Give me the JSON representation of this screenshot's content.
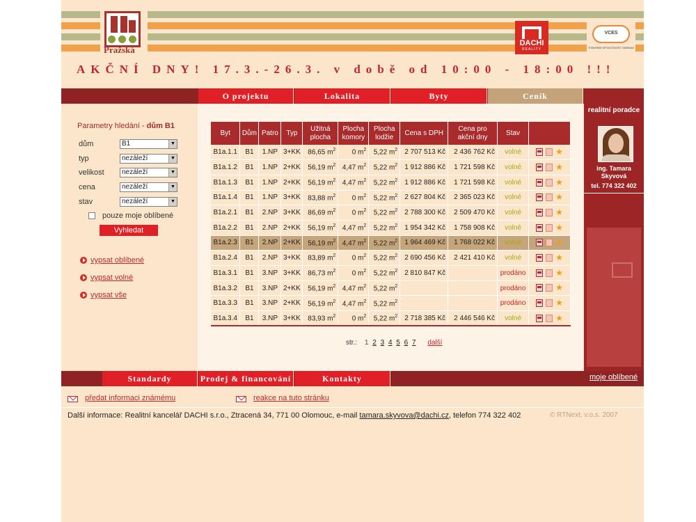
{
  "header": {
    "logo_text": "Pražská",
    "dachi_text": "DACHI",
    "dachi_sub": "REALITY",
    "vces_text": "VCES",
    "vces_sub": "STAVEBNÍ SPOLEČNOST OMNIUM"
  },
  "banner": "AKČNÍ DNY! 17.3.-26.3. v době od 10:00 - 18:00 !!!",
  "nav": [
    "O projektu",
    "Lokalita",
    "Byty",
    "Ceník"
  ],
  "search": {
    "title_prefix": "Parametry hledání - ",
    "title_house": "dům B1",
    "fields": [
      {
        "label": "dům",
        "value": "B1"
      },
      {
        "label": "typ",
        "value": "nezáleží"
      },
      {
        "label": "velikost",
        "value": "nezáleží"
      },
      {
        "label": "cena",
        "value": "nezáleží"
      },
      {
        "label": "stav",
        "value": "nezáleží"
      }
    ],
    "favorites_only": "pouze moje oblíbené",
    "button": "Vyhledat"
  },
  "side_links": [
    "vypsat oblíbené",
    "vypsat volné",
    "vypsat vše"
  ],
  "table": {
    "headers": [
      "Byt",
      "Dům",
      "Patro",
      "Typ",
      "Užitná plocha",
      "Plocha komory",
      "Plocha lodžie",
      "Cena s DPH",
      "Cena pro akční dny",
      "Stav",
      ""
    ],
    "rows": [
      {
        "byt": "B1a.1.1",
        "dum": "B1",
        "patro": "1.NP",
        "typ": "3+KK",
        "uzitna": "86,65 m",
        "komora": "0 m",
        "lodzie": "5,22 m",
        "cena": "2 707 513 Kč",
        "akce": "2 436 762 Kč",
        "stav": "volné"
      },
      {
        "byt": "B1a.1.2",
        "dum": "B1",
        "patro": "1.NP",
        "typ": "2+KK",
        "uzitna": "56,19 m",
        "komora": "4,47 m",
        "lodzie": "5,22 m",
        "cena": "1 912 886 Kč",
        "akce": "1 721 598 Kč",
        "stav": "volné"
      },
      {
        "byt": "B1a.1.3",
        "dum": "B1",
        "patro": "1.NP",
        "typ": "2+KK",
        "uzitna": "56,19 m",
        "komora": "4,47 m",
        "lodzie": "5,22 m",
        "cena": "1 912 886 Kč",
        "akce": "1 721 598 Kč",
        "stav": "volné"
      },
      {
        "byt": "B1a.1.4",
        "dum": "B1",
        "patro": "1.NP",
        "typ": "3+KK",
        "uzitna": "83,88 m",
        "komora": "0 m",
        "lodzie": "5,22 m",
        "cena": "2 627 804 Kč",
        "akce": "2 365 023 Kč",
        "stav": "volné"
      },
      {
        "byt": "B1a.2.1",
        "dum": "B1",
        "patro": "2.NP",
        "typ": "3+KK",
        "uzitna": "86,69 m",
        "komora": "0 m",
        "lodzie": "5,22 m",
        "cena": "2 788 300 Kč",
        "akce": "2 509 470 Kč",
        "stav": "volné"
      },
      {
        "byt": "B1a.2.2",
        "dum": "B1",
        "patro": "2.NP",
        "typ": "2+KK",
        "uzitna": "56,19 m",
        "komora": "4,47 m",
        "lodzie": "5,22 m",
        "cena": "1 954 342 Kč",
        "akce": "1 758 908 Kč",
        "stav": "volné"
      },
      {
        "byt": "B1a.2.3",
        "dum": "B1",
        "patro": "2.NP",
        "typ": "2+KK",
        "uzitna": "56,19 m",
        "komora": "4,47 m",
        "lodzie": "5,22 m",
        "cena": "1 964 469 Kč",
        "akce": "1 768 022 Kč",
        "stav": "volné",
        "highlight": true
      },
      {
        "byt": "B1a.2.4",
        "dum": "B1",
        "patro": "2.NP",
        "typ": "3+KK",
        "uzitna": "83,89 m",
        "komora": "0 m",
        "lodzie": "5,22 m",
        "cena": "2 690 456 Kč",
        "akce": "2 421 410 Kč",
        "stav": "volné"
      },
      {
        "byt": "B1a.3.1",
        "dum": "B1",
        "patro": "3.NP",
        "typ": "3+KK",
        "uzitna": "86,73 m",
        "komora": "0 m",
        "lodzie": "5,22 m",
        "cena": "2 810 847 Kč",
        "akce": "",
        "stav": "prodáno"
      },
      {
        "byt": "B1a.3.2",
        "dum": "B1",
        "patro": "3.NP",
        "typ": "2+KK",
        "uzitna": "56,19 m",
        "komora": "4,47 m",
        "lodzie": "5,22 m",
        "cena": "",
        "akce": "",
        "stav": "prodáno"
      },
      {
        "byt": "B1a.3.3",
        "dum": "B1",
        "patro": "3.NP",
        "typ": "2+KK",
        "uzitna": "56,19 m",
        "komora": "4,47 m",
        "lodzie": "5,22 m",
        "cena": "",
        "akce": "",
        "stav": "prodáno"
      },
      {
        "byt": "B1a.3.4",
        "dum": "B1",
        "patro": "3.NP",
        "typ": "3+KK",
        "uzitna": "83,93 m",
        "komora": "0 m",
        "lodzie": "5,22 m",
        "cena": "2 718 385 Kč",
        "akce": "2 446 546 Kč",
        "stav": "volné"
      }
    ],
    "area_unit_sup": "2",
    "action_icons": [
      "pdf-icon",
      "document-icon",
      "star-icon"
    ]
  },
  "pager": {
    "label": "str.:",
    "current": "1",
    "pages": [
      "2",
      "3",
      "4",
      "5",
      "6",
      "7"
    ],
    "next": "další"
  },
  "advisor": {
    "title": "realitní poradce",
    "name": "ing. Tamara Skyvová",
    "tel": "tel. 774 322 402"
  },
  "bottom_nav": [
    "Standardy",
    "Prodej & financování",
    "Kontakty"
  ],
  "favorites_link": "moje oblíbené",
  "footer": {
    "link1": "předat informaci známému",
    "link2": "reakce na tuto stránku",
    "info_prefix": "Další informace: Realitní kancelář DACHI s.r.o., Ztracená 34, 771 00 Olomouc, e-mail ",
    "email": "tamara.skyvova@dachi.cz",
    "info_suffix": ", telefon 774 322 402",
    "copyright": "© RTNext, v.o.s. 2007"
  },
  "colors": {
    "brand_red": "#e01f27",
    "dark_red": "#a92b2c",
    "cream": "#fbe6cb",
    "status_free": "#a4a816",
    "status_sold": "#c4242b"
  }
}
